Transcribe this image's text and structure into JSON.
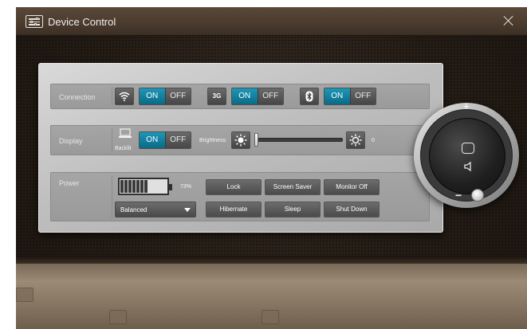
{
  "window": {
    "title": "Device Control"
  },
  "icons": {
    "app": "sliders-icon",
    "close": "close-icon",
    "wifi": "wifi-icon",
    "mobile": "3g-icon",
    "bluetooth": "bluetooth-icon",
    "backlight": "laptop-icon",
    "brightness_low": "sun-icon",
    "brightness_high": "sun-outline-icon",
    "battery": "battery-icon",
    "display_mode": "display-mode-icon",
    "volume": "speaker-icon"
  },
  "connection": {
    "label": "Connection",
    "wifi": {
      "on": "ON",
      "off": "OFF",
      "state": "on"
    },
    "mobile": {
      "icon_text": "3G",
      "on": "ON",
      "off": "OFF",
      "state": "on"
    },
    "bluetooth": {
      "on": "ON",
      "off": "OFF",
      "state": "on"
    }
  },
  "display": {
    "label": "Display",
    "backlit_label": "Backlit",
    "backlit": {
      "on": "ON",
      "off": "OFF",
      "state": "on"
    },
    "brightness_label": "Brightness",
    "brightness_value": "0",
    "brightness_level": 0
  },
  "power": {
    "label": "Power",
    "battery_percent": "73%",
    "battery_level": 0.73,
    "plan": "Balanced",
    "buttons": {
      "lock": "Lock",
      "screen_saver": "Screen Saver",
      "monitor_off": "Monitor Off",
      "hibernate": "Hibernate",
      "sleep": "Sleep",
      "shut_down": "Shut Down"
    }
  },
  "volume": {
    "plus": "+",
    "minus": "−"
  },
  "colors": {
    "accent": "#0b86a8",
    "panel": "#bdbdbd",
    "titlebar": "#4a3b2e"
  }
}
